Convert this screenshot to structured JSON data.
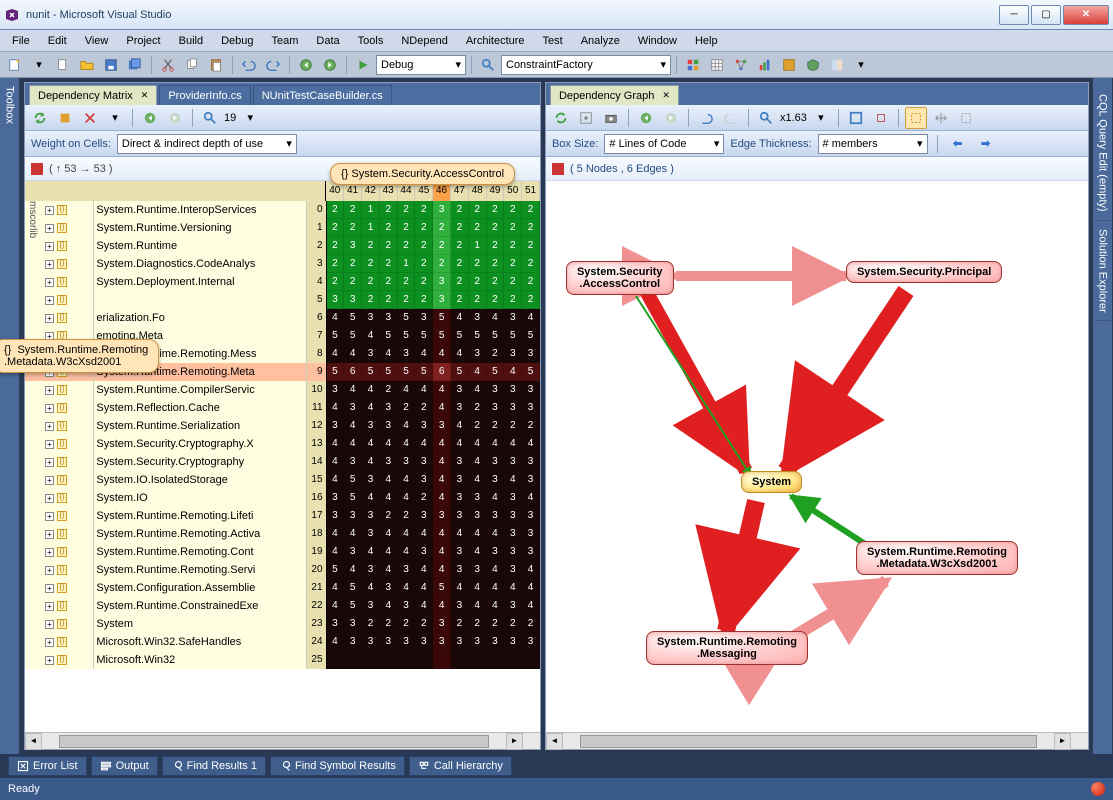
{
  "window": {
    "title": "nunit - Microsoft Visual Studio"
  },
  "menu": [
    "File",
    "Edit",
    "View",
    "Project",
    "Build",
    "Debug",
    "Team",
    "Data",
    "Tools",
    "NDepend",
    "Architecture",
    "Test",
    "Analyze",
    "Window",
    "Help"
  ],
  "toolbar_combos": {
    "config": "Debug",
    "find": "ConstraintFactory"
  },
  "left_sidetab": "Toolbox",
  "right_sidetabs": [
    "CQL Query Edit (empty)",
    "Solution Explorer"
  ],
  "left_pane": {
    "tabs": [
      "Dependency Matrix",
      "ProviderInfo.cs",
      "NUnitTestCaseBuilder.cs"
    ],
    "active_tab": 0,
    "weight_label": "Weight on Cells:",
    "weight_value": "Direct & indirect depth of use",
    "zoom": "19",
    "nav_coords": "(  ↑ 53  → 53  )",
    "tooltip_top": "{}  System.Security.AccessControl",
    "tooltip_left": "{}  System.Runtime.Remoting\n.Metadata.W3cXsd2001",
    "tree_label": "mscorlib",
    "columns": [
      "40",
      "41",
      "42",
      "43",
      "44",
      "45",
      "46",
      "47",
      "48",
      "49",
      "50",
      "51"
    ],
    "hi_col": 6,
    "rows": [
      {
        "name": "System.Runtime.InteropServices",
        "idx": "0",
        "cls": "green",
        "cells": [
          "2",
          "2",
          "1",
          "2",
          "2",
          "2",
          "3",
          "2",
          "2",
          "2",
          "2",
          "2"
        ]
      },
      {
        "name": "System.Runtime.Versioning",
        "idx": "1",
        "cls": "green",
        "cells": [
          "2",
          "2",
          "1",
          "2",
          "2",
          "2",
          "2",
          "2",
          "2",
          "2",
          "2",
          "2"
        ]
      },
      {
        "name": "System.Runtime",
        "idx": "2",
        "cls": "green",
        "cells": [
          "2",
          "3",
          "2",
          "2",
          "2",
          "2",
          "2",
          "2",
          "1",
          "2",
          "2",
          "2"
        ]
      },
      {
        "name": "System.Diagnostics.CodeAnalys",
        "idx": "3",
        "cls": "green",
        "cells": [
          "2",
          "2",
          "2",
          "2",
          "1",
          "2",
          "2",
          "2",
          "2",
          "2",
          "2",
          "2"
        ]
      },
      {
        "name": "System.Deployment.Internal",
        "idx": "4",
        "cls": "green",
        "cells": [
          "2",
          "2",
          "2",
          "2",
          "2",
          "2",
          "3",
          "2",
          "2",
          "2",
          "2",
          "2"
        ]
      },
      {
        "name": "",
        "idx": "5",
        "cls": "green",
        "cells": [
          "3",
          "3",
          "2",
          "2",
          "2",
          "2",
          "3",
          "2",
          "2",
          "2",
          "2",
          "2"
        ]
      },
      {
        "name": "erialization.Fo",
        "idx": "6",
        "cls": "dark",
        "cells": [
          "4",
          "5",
          "3",
          "3",
          "5",
          "3",
          "5",
          "4",
          "3",
          "4",
          "3",
          "4"
        ]
      },
      {
        "name": "emoting.Meta",
        "idx": "7",
        "cls": "dark",
        "cells": [
          "5",
          "5",
          "4",
          "5",
          "5",
          "5",
          "5",
          "5",
          "5",
          "5",
          "5",
          "5"
        ]
      },
      {
        "name": "System.Runtime.Remoting.Mess",
        "idx": "8",
        "cls": "dark",
        "cells": [
          "4",
          "4",
          "3",
          "4",
          "3",
          "4",
          "4",
          "4",
          "3",
          "2",
          "3",
          "3"
        ]
      },
      {
        "name": "System.Runtime.Remoting.Meta",
        "idx": "9",
        "cls": "red",
        "sel": true,
        "cells": [
          "5",
          "6",
          "5",
          "5",
          "5",
          "5",
          "6",
          "5",
          "4",
          "5",
          "4",
          "5"
        ]
      },
      {
        "name": "System.Runtime.CompilerServic",
        "idx": "10",
        "cls": "dark",
        "cells": [
          "3",
          "4",
          "4",
          "2",
          "4",
          "4",
          "4",
          "3",
          "4",
          "3",
          "3",
          "3"
        ]
      },
      {
        "name": "System.Reflection.Cache",
        "idx": "11",
        "cls": "dark",
        "cells": [
          "4",
          "3",
          "4",
          "3",
          "2",
          "2",
          "4",
          "3",
          "2",
          "3",
          "3",
          "3"
        ]
      },
      {
        "name": "System.Runtime.Serialization",
        "idx": "12",
        "cls": "dark",
        "cells": [
          "3",
          "4",
          "3",
          "3",
          "4",
          "3",
          "3",
          "4",
          "2",
          "2",
          "2",
          "2"
        ]
      },
      {
        "name": "System.Security.Cryptography.X",
        "idx": "13",
        "cls": "dark",
        "cells": [
          "4",
          "4",
          "4",
          "4",
          "4",
          "4",
          "4",
          "4",
          "4",
          "4",
          "4",
          "4"
        ]
      },
      {
        "name": "System.Security.Cryptography",
        "idx": "14",
        "cls": "dark",
        "cells": [
          "4",
          "3",
          "4",
          "3",
          "3",
          "3",
          "4",
          "3",
          "4",
          "3",
          "3",
          "3"
        ]
      },
      {
        "name": "System.IO.IsolatedStorage",
        "idx": "15",
        "cls": "dark",
        "cells": [
          "4",
          "5",
          "3",
          "4",
          "4",
          "3",
          "4",
          "3",
          "4",
          "3",
          "4",
          "3"
        ]
      },
      {
        "name": "System.IO",
        "idx": "16",
        "cls": "dark",
        "cells": [
          "3",
          "5",
          "4",
          "4",
          "4",
          "2",
          "4",
          "3",
          "3",
          "4",
          "3",
          "4"
        ]
      },
      {
        "name": "System.Runtime.Remoting.Lifeti",
        "idx": "17",
        "cls": "dark",
        "cells": [
          "3",
          "3",
          "3",
          "2",
          "2",
          "3",
          "3",
          "3",
          "3",
          "3",
          "3",
          "3"
        ]
      },
      {
        "name": "System.Runtime.Remoting.Activa",
        "idx": "18",
        "cls": "dark",
        "cells": [
          "4",
          "4",
          "3",
          "4",
          "4",
          "4",
          "4",
          "4",
          "4",
          "4",
          "3",
          "3"
        ]
      },
      {
        "name": "System.Runtime.Remoting.Cont",
        "idx": "19",
        "cls": "dark",
        "cells": [
          "4",
          "3",
          "4",
          "4",
          "4",
          "3",
          "4",
          "3",
          "4",
          "3",
          "3",
          "3"
        ]
      },
      {
        "name": "System.Runtime.Remoting.Servi",
        "idx": "20",
        "cls": "dark",
        "cells": [
          "5",
          "4",
          "3",
          "4",
          "3",
          "4",
          "4",
          "3",
          "3",
          "4",
          "3",
          "4"
        ]
      },
      {
        "name": "System.Configuration.Assemblie",
        "idx": "21",
        "cls": "dark",
        "cells": [
          "4",
          "5",
          "4",
          "3",
          "4",
          "4",
          "5",
          "4",
          "4",
          "4",
          "4",
          "4"
        ]
      },
      {
        "name": "System.Runtime.ConstrainedExe",
        "idx": "22",
        "cls": "dark",
        "cells": [
          "4",
          "5",
          "3",
          "4",
          "3",
          "4",
          "4",
          "3",
          "4",
          "4",
          "3",
          "4"
        ]
      },
      {
        "name": "System",
        "idx": "23",
        "cls": "dark",
        "cells": [
          "3",
          "3",
          "2",
          "2",
          "2",
          "2",
          "3",
          "2",
          "2",
          "2",
          "2",
          "2"
        ]
      },
      {
        "name": "Microsoft.Win32.SafeHandles",
        "idx": "24",
        "cls": "dark",
        "cells": [
          "4",
          "3",
          "3",
          "3",
          "3",
          "3",
          "3",
          "3",
          "3",
          "3",
          "3",
          "3"
        ]
      },
      {
        "name": "Microsoft.Win32",
        "idx": "25",
        "cls": "dark",
        "cells": [
          "",
          "",
          "",
          "",
          "",
          "",
          "",
          "",
          "",
          "",
          "",
          ""
        ]
      }
    ]
  },
  "right_pane": {
    "tab": "Dependency Graph",
    "box_size_label": "Box Size:",
    "box_size_value": "# Lines of Code",
    "edge_label": "Edge Thickness:",
    "edge_value": "# members",
    "zoom": "x1.63",
    "nav": "(  5 Nodes  ,  6 Edges  )",
    "nodes": {
      "n1": "System.Security\n.AccessControl",
      "n2": "System.Security.Principal",
      "n3": "System",
      "n4": "System.Runtime.Remoting\n.Metadata.W3cXsd2001",
      "n5": "System.Runtime.Remoting\n.Messaging"
    }
  },
  "bottom_tabs": [
    "Error List",
    "Output",
    "Find Results 1",
    "Find Symbol Results",
    "Call Hierarchy"
  ],
  "status": "Ready"
}
